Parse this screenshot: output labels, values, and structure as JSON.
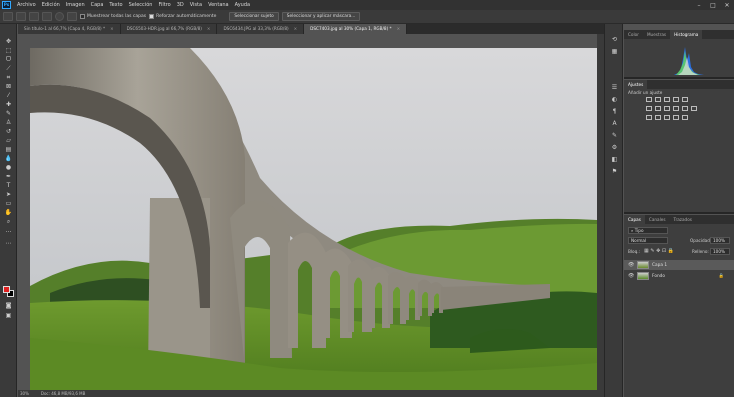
{
  "app": {
    "logo": "Ps"
  },
  "menu": [
    "Archivo",
    "Edición",
    "Imagen",
    "Capa",
    "Texto",
    "Selección",
    "Filtro",
    "3D",
    "Vista",
    "Ventana",
    "Ayuda"
  ],
  "options": {
    "sample_all_layers": "Muestrear todas las capas",
    "auto_enhance": "Reforzar automáticamente",
    "select_subject": "Seleccionar sujeto",
    "select_mask": "Seleccionar y aplicar máscara..."
  },
  "tabs": [
    {
      "label": "Sin título-1 al 66,7% (Capa 4, RGB/8) *",
      "active": false
    },
    {
      "label": "DSC6503-HDR.jpg al 66,7% (RGB/8)",
      "active": false
    },
    {
      "label": "DSC6434.JPG al 33,3% (RGB/8)",
      "active": false
    },
    {
      "label": "DSC7403.jpg al 30% (Capa 1, RGB/8) *",
      "active": true
    }
  ],
  "tab_close": "×",
  "status": {
    "zoom": "30%",
    "doc": "Doc: 46,8 MB/93,6 MB"
  },
  "panels": {
    "top_tabs": [
      "Color",
      "Muestras",
      "Histograma"
    ],
    "adjust_tab": "Ajustes",
    "adjust_hint": "Añadir un ajuste",
    "layers_tabs": [
      "Capas",
      "Canales",
      "Trazados"
    ],
    "kind_filter": "Tipo",
    "blend_mode": "Normal",
    "opacity_label": "Opacidad:",
    "opacity_value": "100%",
    "lock_label": "Bloq.:",
    "fill_label": "Relleno:",
    "fill_value": "100%",
    "layers": [
      {
        "name": "Capa 1",
        "selected": true
      },
      {
        "name": "Fondo",
        "selected": false
      }
    ]
  },
  "colors": {
    "foreground": "#e02020",
    "background": "#000000",
    "accent": "#31a8ff"
  }
}
